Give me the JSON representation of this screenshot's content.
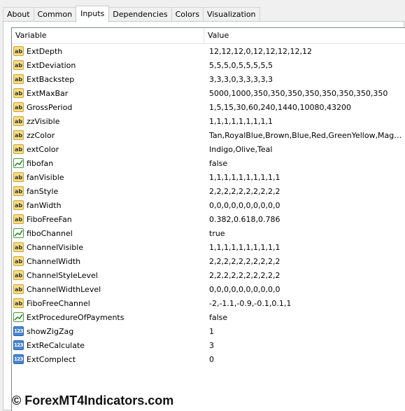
{
  "tabs": [
    "About",
    "Common",
    "Inputs",
    "Dependencies",
    "Colors",
    "Visualization"
  ],
  "active_tab": "Inputs",
  "grid": {
    "header": {
      "variable": "Variable",
      "value": "Value"
    },
    "rows": [
      {
        "type": "string",
        "icon": "ab",
        "name": "ExtDepth",
        "value": "12,12,12,0,12,12,12,12,12"
      },
      {
        "type": "string",
        "icon": "ab",
        "name": "ExtDeviation",
        "value": "5,5,5,0,5,5,5,5,5"
      },
      {
        "type": "string",
        "icon": "ab",
        "name": "ExtBackstep",
        "value": "3,3,3,0,3,3,3,3,3"
      },
      {
        "type": "string",
        "icon": "ab",
        "name": "ExtMaxBar",
        "value": "5000,1000,350,350,350,350,350,350,350,350"
      },
      {
        "type": "string",
        "icon": "ab",
        "name": "GrossPeriod",
        "value": "1,5,15,30,60,240,1440,10080,43200"
      },
      {
        "type": "string",
        "icon": "ab",
        "name": "zzVisible",
        "value": "1,1,1,1,1,1,1,1,1"
      },
      {
        "type": "string",
        "icon": "ab",
        "name": "zzColor",
        "value": "Tan,RoyalBlue,Brown,Blue,Red,GreenYellow,Magenta,I..."
      },
      {
        "type": "string",
        "icon": "ab",
        "name": "extColor",
        "value": "Indigo,Olive,Teal"
      },
      {
        "type": "bool",
        "icon": "bool",
        "name": "fibofan",
        "value": "false"
      },
      {
        "type": "string",
        "icon": "ab",
        "name": "fanVisible",
        "value": "1,1,1,1,1,1,1,1,1,1"
      },
      {
        "type": "string",
        "icon": "ab",
        "name": "fanStyle",
        "value": "2,2,2,2,2,2,2,2,2,2"
      },
      {
        "type": "string",
        "icon": "ab",
        "name": "fanWidth",
        "value": "0,0,0,0,0,0,0,0,0,0"
      },
      {
        "type": "string",
        "icon": "ab",
        "name": "FiboFreeFan",
        "value": "0.382,0.618,0.786"
      },
      {
        "type": "bool",
        "icon": "bool",
        "name": "fiboChannel",
        "value": "true"
      },
      {
        "type": "string",
        "icon": "ab",
        "name": "ChannelVisible",
        "value": "1,1,1,1,1,1,1,1,1,1"
      },
      {
        "type": "string",
        "icon": "ab",
        "name": "ChannelWidth",
        "value": "2,2,2,2,2,2,2,2,2,2"
      },
      {
        "type": "string",
        "icon": "ab",
        "name": "ChannelStyleLevel",
        "value": "2,2,2,2,2,2,2,2,2,2"
      },
      {
        "type": "string",
        "icon": "ab",
        "name": "ChannelWidthLevel",
        "value": "0,0,0,0,0,0,0,0,0,0"
      },
      {
        "type": "string",
        "icon": "ab",
        "name": "FiboFreeChannel",
        "value": "-2,-1.1,-0.9,-0.1,0.1,1"
      },
      {
        "type": "bool",
        "icon": "bool",
        "name": "ExtProcedureOfPayments",
        "value": "false"
      },
      {
        "type": "int",
        "icon": "123",
        "name": "showZigZag",
        "value": "1"
      },
      {
        "type": "int",
        "icon": "123",
        "name": "ExtReCalculate",
        "value": "3"
      },
      {
        "type": "int",
        "icon": "123",
        "name": "ExtComplect",
        "value": "0"
      }
    ]
  },
  "watermark": "© ForexMT4Indicators.com"
}
